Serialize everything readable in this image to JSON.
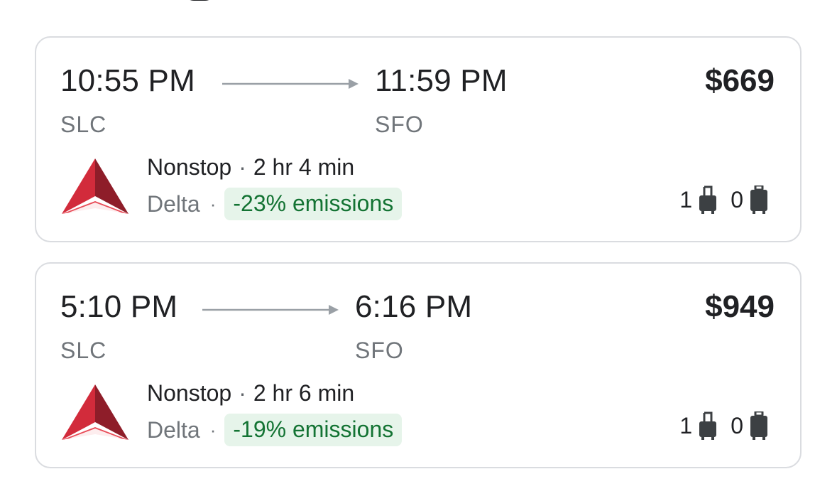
{
  "flights": [
    {
      "departure_time": "10:55 PM",
      "arrival_time": "11:59 PM",
      "origin": "SLC",
      "destination": "SFO",
      "price": "$669",
      "stops": "Nonstop",
      "separator": "·",
      "duration": "2 hr 4 min",
      "airline": "Delta",
      "emissions": "-23% emissions",
      "carry_on_count": "1",
      "checked_bag_count": "0"
    },
    {
      "departure_time": "5:10 PM",
      "arrival_time": "6:16 PM",
      "origin": "SLC",
      "destination": "SFO",
      "price": "$949",
      "stops": "Nonstop",
      "separator": "·",
      "duration": "2 hr 6 min",
      "airline": "Delta",
      "emissions": "-19% emissions",
      "carry_on_count": "1",
      "checked_bag_count": "0"
    }
  ],
  "icons": {
    "airline_logo": "delta-logo-icon",
    "arrow": "arrow-right-icon",
    "carry_on": "carry-on-bag-icon",
    "checked": "checked-bag-icon"
  },
  "colors": {
    "emissions_bg": "#e6f4ea",
    "emissions_text": "#137333",
    "delta_red": "#c8102e",
    "card_border": "#dadce0"
  }
}
